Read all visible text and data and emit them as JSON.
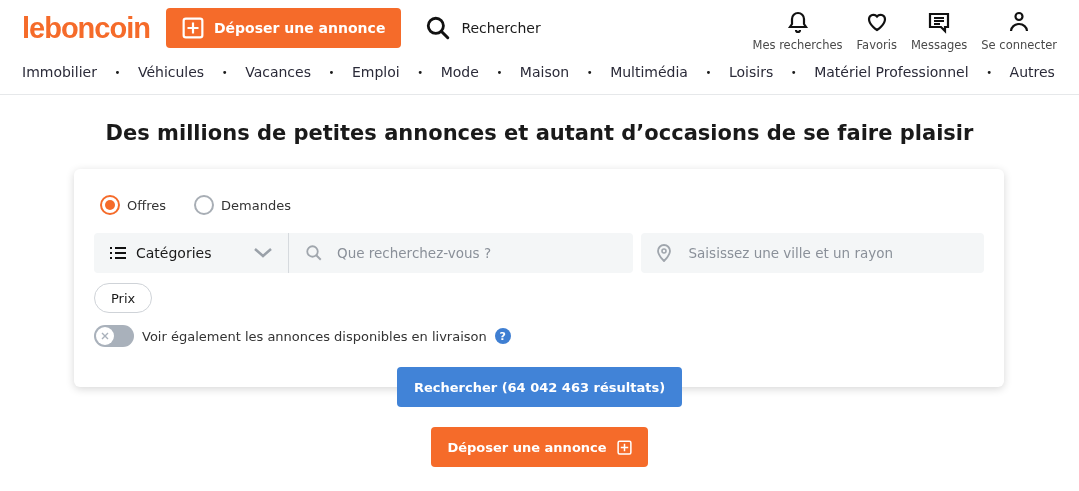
{
  "header": {
    "logo": "leboncoin",
    "post_button": "Déposer une annonce",
    "search_link": "Rechercher",
    "actions": [
      {
        "kind": "bell",
        "label": "Mes recherches"
      },
      {
        "kind": "heart",
        "label": "Favoris"
      },
      {
        "kind": "message",
        "label": "Messages"
      },
      {
        "kind": "user",
        "label": "Se connecter"
      }
    ]
  },
  "nav": [
    {
      "kind": "link",
      "text": "Immobilier"
    },
    {
      "kind": "separator",
      "text": "•"
    },
    {
      "kind": "link",
      "text": "Véhicules"
    },
    {
      "kind": "separator",
      "text": "•"
    },
    {
      "kind": "link",
      "text": "Vacances"
    },
    {
      "kind": "separator",
      "text": "•"
    },
    {
      "kind": "link",
      "text": "Emploi"
    },
    {
      "kind": "separator",
      "text": "•"
    },
    {
      "kind": "link",
      "text": "Mode"
    },
    {
      "kind": "separator",
      "text": "•"
    },
    {
      "kind": "link",
      "text": "Maison"
    },
    {
      "kind": "separator",
      "text": "•"
    },
    {
      "kind": "link",
      "text": "Multimédia"
    },
    {
      "kind": "separator",
      "text": "•"
    },
    {
      "kind": "link",
      "text": "Loisirs"
    },
    {
      "kind": "separator",
      "text": "•"
    },
    {
      "kind": "link",
      "text": "Matériel Professionnel"
    },
    {
      "kind": "separator",
      "text": "•"
    },
    {
      "kind": "link",
      "text": "Autres"
    }
  ],
  "headline": "Des millions de petites annonces et autant d’occasions de se faire plaisir",
  "search_form": {
    "types": [
      {
        "label": "Offres",
        "selected": true
      },
      {
        "label": "Demandes",
        "selected": false
      }
    ],
    "category": "Catégories",
    "query": {
      "placeholder": "Que recherchez-vous ?"
    },
    "location": {
      "placeholder": "Saisissez une ville et un rayon"
    },
    "price_filter": "Prix",
    "delivery_toggle": {
      "label": "Voir également les annonces disponibles en livraison",
      "on": false,
      "help": "?"
    },
    "submit": "Rechercher (64 042 463 résultats)"
  },
  "bottom_button": "Déposer une annonce"
}
